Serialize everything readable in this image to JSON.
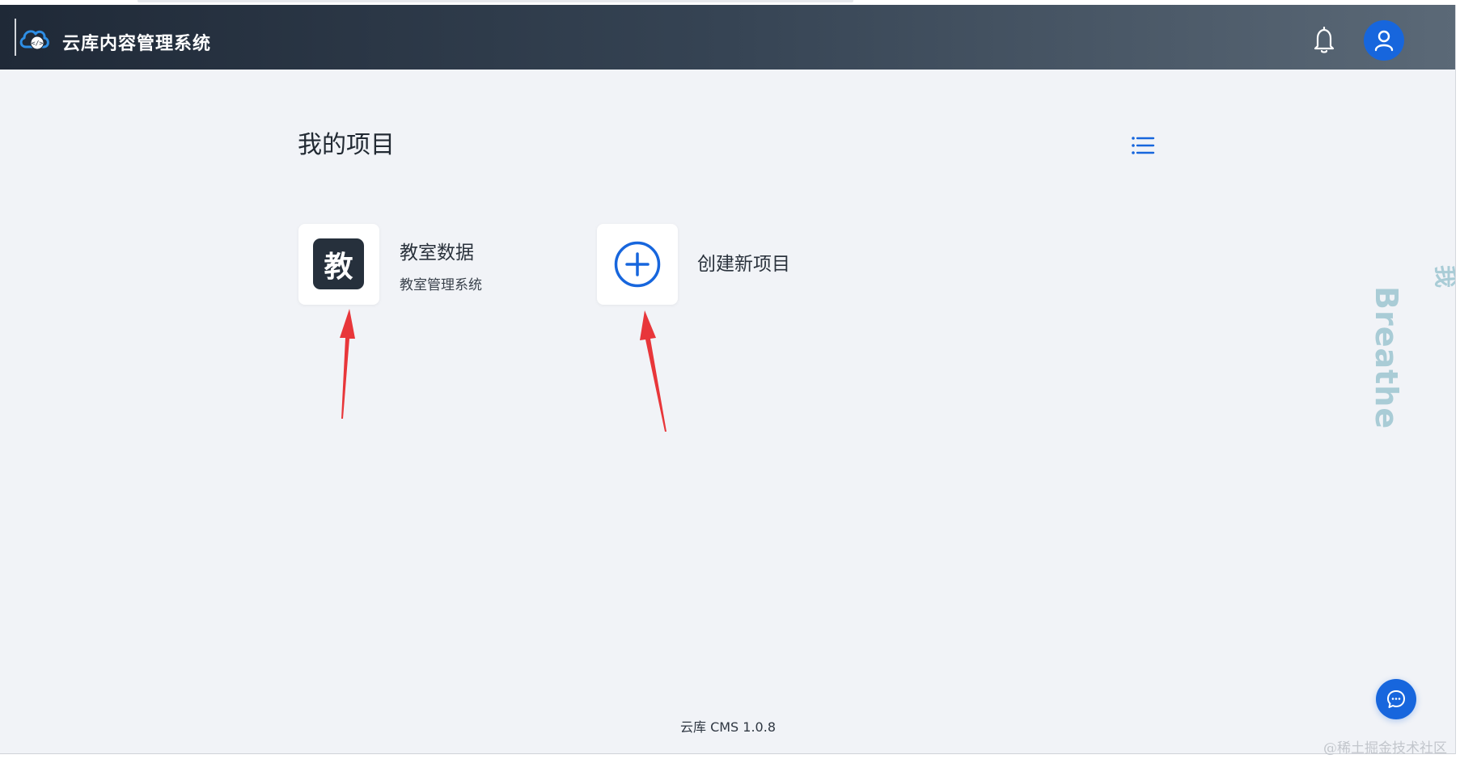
{
  "header": {
    "app_title": "云库内容管理系统",
    "logo_icon": "cloud-code-logo",
    "notification_icon": "bell-icon",
    "user_icon": "user-avatar-icon",
    "brand_color": "#1766dd"
  },
  "main": {
    "section_title": "我的项目",
    "view_toggle_icon": "list-view-icon",
    "projects": [
      {
        "badge": "教",
        "name": "教室数据",
        "description": "教室管理系统"
      }
    ],
    "create_project": {
      "icon": "plus-circle-icon",
      "label": "创建新项目"
    },
    "annotation": "red-arrows-pointing-to-cards"
  },
  "footer": {
    "version": "云库 CMS 1.0.8"
  },
  "chat_button_icon": "chat-bubble-icon",
  "watermarks": {
    "side_text": "Breathe",
    "side_text_2": "我",
    "bottom_text": "@稀土掘金技术社区"
  }
}
